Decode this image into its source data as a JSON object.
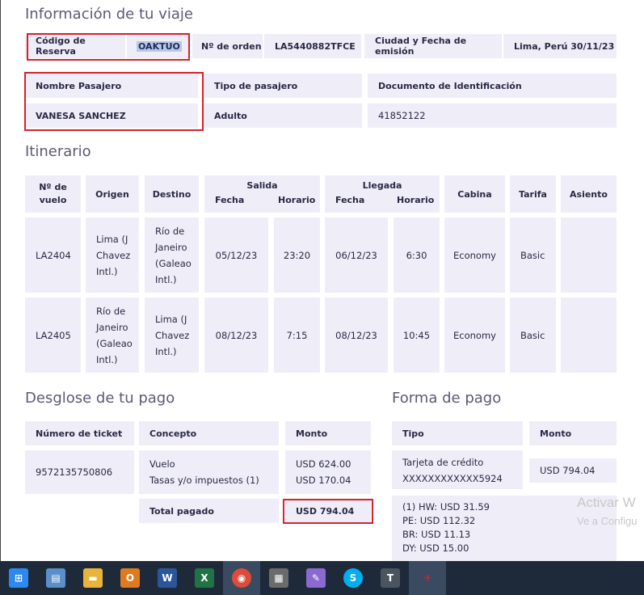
{
  "sections": {
    "trip_info": "Información de tu viaje",
    "itinerary": "Itinerario",
    "payment_breakdown": "Desglose de tu pago",
    "payment_method": "Forma de pago"
  },
  "trip": {
    "reservation_code_label": "Código de Reserva",
    "reservation_code": "OAKTUO",
    "order_number_label": "Nº de orden",
    "order_number": "LA5440882TFCE",
    "issue_label": "Ciudad y Fecha de emisión",
    "issue_value": "Lima, Perú 30/11/23",
    "passenger_name_label": "Nombre Pasajero",
    "passenger_name": "VANESA SANCHEZ",
    "passenger_type_label": "Tipo de pasajero",
    "passenger_type": "Adulto",
    "id_document_label": "Documento de Identificación",
    "id_document": "41852122"
  },
  "itinerary": {
    "headers": {
      "flight": [
        "Nº de",
        "vuelo"
      ],
      "origin": "Origen",
      "destination": "Destino",
      "departure": "Salida",
      "arrival": "Llegada",
      "date": "Fecha",
      "time": "Horario",
      "cabin": "Cabina",
      "fare": "Tarifa",
      "seat": "Asiento"
    },
    "rows": [
      {
        "flight": "LA2404",
        "origin": [
          "Lima (J",
          "Chavez",
          "Intl.)"
        ],
        "destination": [
          "Río de",
          "Janeiro",
          "(Galeao",
          "Intl.)"
        ],
        "dep_date": "05/12/23",
        "dep_time": "23:20",
        "arr_date": "06/12/23",
        "arr_time": "6:30",
        "cabin": "Economy",
        "fare": "Basic",
        "seat": ""
      },
      {
        "flight": "LA2405",
        "origin": [
          "Río de",
          "Janeiro",
          "(Galeao",
          "Intl.)"
        ],
        "destination": [
          "Lima (J",
          "Chavez",
          "Intl.)"
        ],
        "dep_date": "08/12/23",
        "dep_time": "7:15",
        "arr_date": "08/12/23",
        "arr_time": "10:45",
        "cabin": "Economy",
        "fare": "Basic",
        "seat": ""
      }
    ]
  },
  "breakdown": {
    "ticket_label": "Número de ticket",
    "concept_label": "Concepto",
    "amount_label": "Monto",
    "ticket": "9572135750806",
    "concept_1": "Vuelo",
    "concept_2": "Tasas y/o impuestos (1)",
    "amount_1": "USD 624.00",
    "amount_2": "USD 170.04",
    "total_label": "Total pagado",
    "total": "USD 794.04"
  },
  "payment": {
    "type_label": "Tipo",
    "amount_label": "Monto",
    "type_1": "Tarjeta de crédito",
    "card": "XXXXXXXXXXXX5924",
    "amount": "USD 794.04",
    "taxes": [
      "(1) HW: USD 31.59",
      "PE: USD 112.32",
      "BR: USD 11.13",
      "DY: USD 15.00"
    ]
  },
  "watermark": {
    "line1": "Activar W",
    "line2": "Ve a Configu"
  },
  "taskbar": {
    "icons": [
      "start-icon",
      "notepad-icon",
      "file-explorer-icon",
      "outlook-icon",
      "word-icon",
      "excel-icon",
      "chrome-icon",
      "calculator-icon",
      "paint-icon",
      "skype-icon",
      "typora-icon",
      "latam-icon"
    ],
    "glyphs": [
      "⊞",
      "▤",
      "▬",
      "O",
      "W",
      "X",
      "◉",
      "▦",
      "✎",
      "S",
      "T",
      "✈"
    ],
    "colors": [
      "#2d89ef",
      "#5a8fc9",
      "#e8b43a",
      "#e07a1f",
      "#2b579a",
      "#217346",
      "#dd4b39",
      "#6b6b6b",
      "#8a6ad0",
      "#00aff0",
      "#4a5560",
      "#d9202b"
    ]
  }
}
